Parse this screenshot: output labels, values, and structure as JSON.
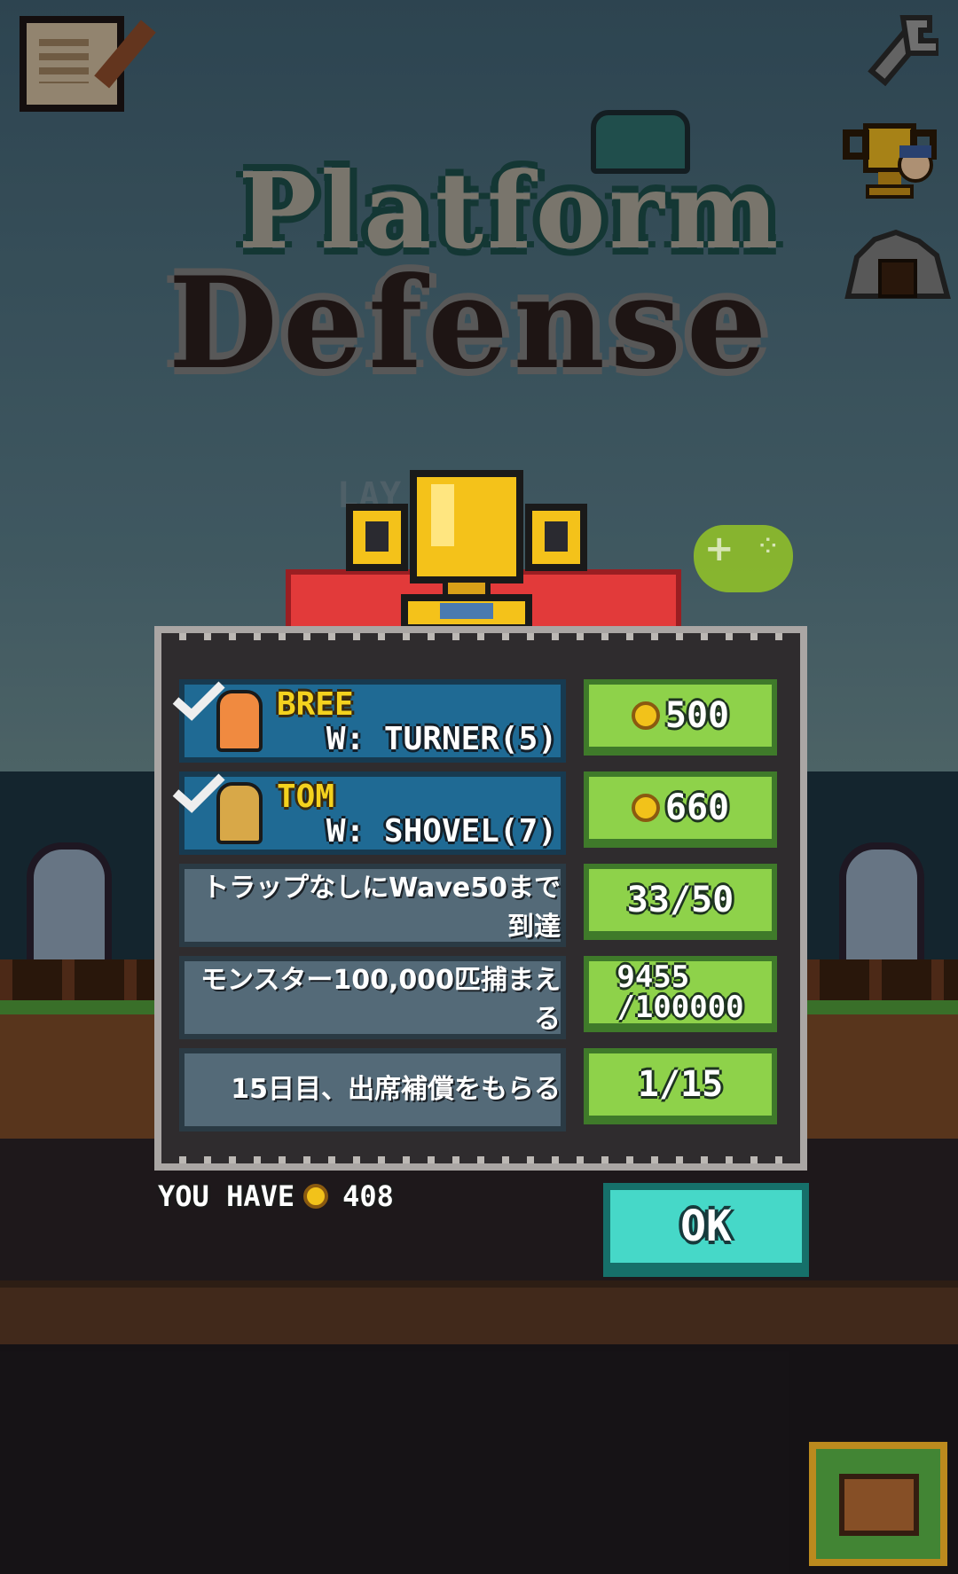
{
  "title": {
    "line1": "Platform",
    "line2": "Defense"
  },
  "background_label": "LAY",
  "achievements": [
    {
      "type": "hero",
      "name": "BREE",
      "requirement": "W: TURNER(5)",
      "button": "500",
      "completed": true
    },
    {
      "type": "hero",
      "name": "TOM",
      "requirement": "W: SHOVEL(7)",
      "button": "660",
      "completed": true
    },
    {
      "type": "task",
      "description": "トラップなしにWave50まで到達",
      "button": "33/50"
    },
    {
      "type": "task",
      "description": "モンスター100,000匹捕まえる",
      "button_line1": "9455",
      "button_line2": "/100000"
    },
    {
      "type": "task",
      "description": "15日目、出席補償をもらる",
      "button": "1/15"
    }
  ],
  "footer": {
    "you_have_label": "YOU HAVE",
    "coins": "408",
    "ok_label": "OK"
  },
  "icons": [
    "notes-icon",
    "wrench-icon",
    "trophy-icon",
    "cave-icon",
    "gamepad-icon",
    "chest-icon",
    "coin-icon",
    "check-icon"
  ],
  "colors": {
    "panel": "#2f2c2e",
    "hero_row": "#1f6a94",
    "task_row": "#546a78",
    "green_button": "#8ed24a",
    "ok_button": "#46d8c8",
    "ribbon": "#e23a3a",
    "gold": "#f2c21a"
  }
}
